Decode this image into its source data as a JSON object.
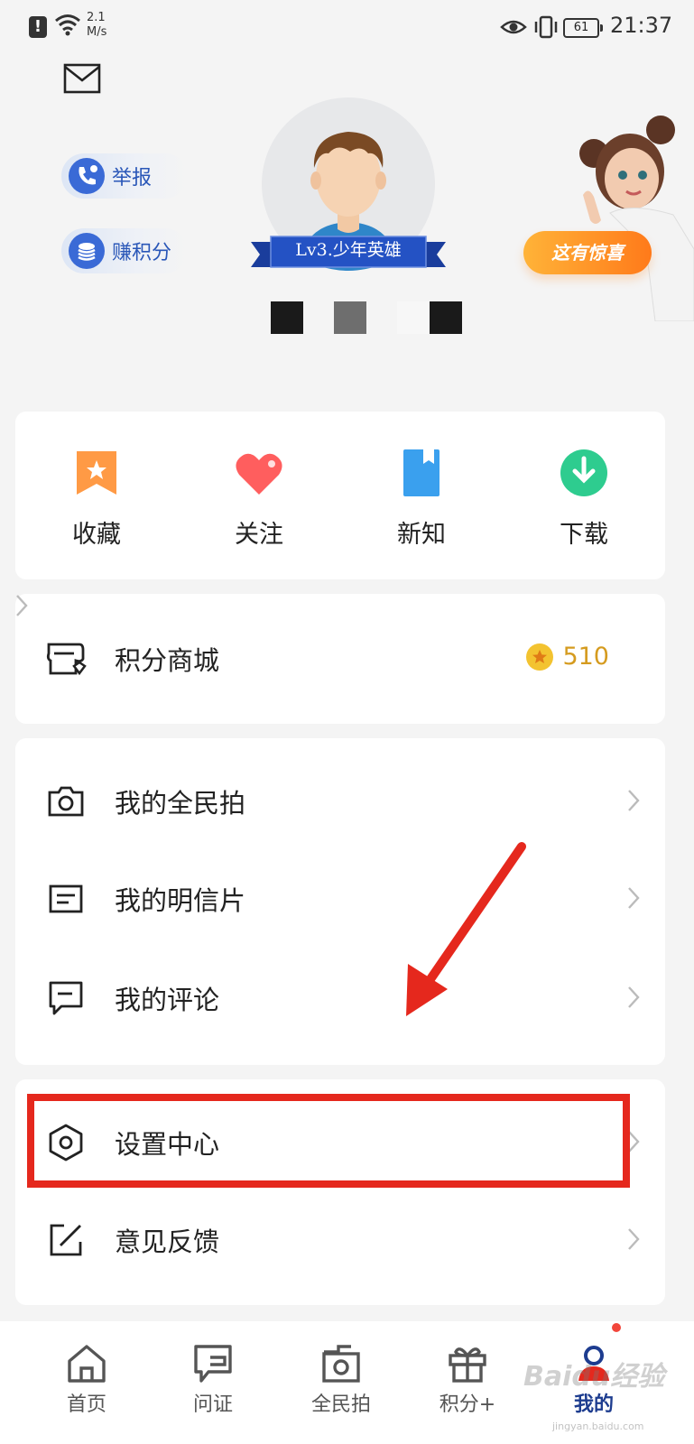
{
  "status_bar": {
    "network_speed_value": "2.1",
    "network_speed_unit": "M/s",
    "battery": "61",
    "time": "21:37"
  },
  "profile": {
    "level_title": "Lv3.少年英雄",
    "report_label": "举报",
    "earn_points_label": "赚积分",
    "surprise_label": "这有惊喜"
  },
  "quick_actions": [
    {
      "label": "收藏",
      "icon": "bookmark-star-icon",
      "color": "#ff9a45"
    },
    {
      "label": "关注",
      "icon": "heart-icon",
      "color": "#ff5e5e"
    },
    {
      "label": "新知",
      "icon": "book-icon",
      "color": "#3aa0ee"
    },
    {
      "label": "下载",
      "icon": "download-icon",
      "color": "#2ecc8f"
    }
  ],
  "points_mall": {
    "label": "积分商城",
    "points": "510",
    "icon": "shop-icon"
  },
  "my_items": [
    {
      "label": "我的全民拍",
      "icon": "camera-icon"
    },
    {
      "label": "我的明信片",
      "icon": "postcard-icon"
    },
    {
      "label": "我的评论",
      "icon": "comment-icon"
    }
  ],
  "settings_items": [
    {
      "label": "设置中心",
      "icon": "settings-hexagon-icon"
    },
    {
      "label": "意见反馈",
      "icon": "feedback-edit-icon"
    }
  ],
  "tabs": [
    {
      "label": "首页",
      "icon": "home-icon"
    },
    {
      "label": "问证",
      "icon": "question-card-icon"
    },
    {
      "label": "全民拍",
      "icon": "camera-icon"
    },
    {
      "label": "积分+",
      "icon": "gift-icon"
    },
    {
      "label": "我的",
      "icon": "user-icon",
      "active": true
    }
  ],
  "watermark": {
    "text": "Baidu经验",
    "url_text": "jingyan.baidu.com"
  },
  "colors": {
    "accent": "#1d3c8f",
    "highlight_box": "#e5281d",
    "points": "#d59b1f"
  }
}
